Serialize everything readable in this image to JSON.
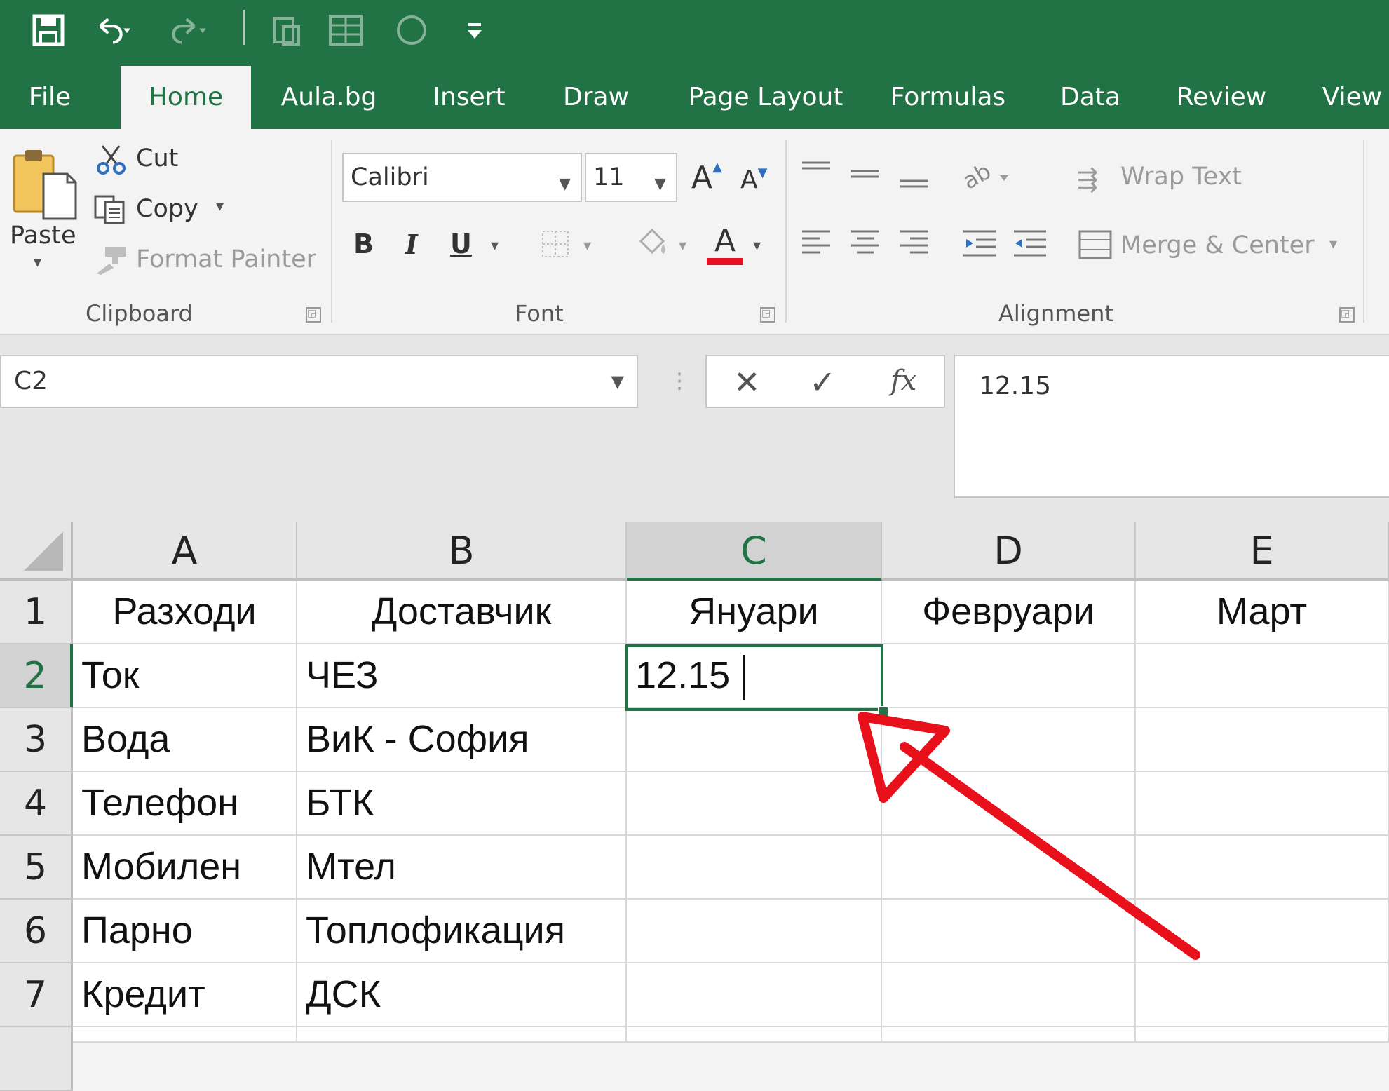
{
  "ribbon_tabs": [
    "File",
    "Home",
    "Aula.bg",
    "Insert",
    "Draw",
    "Page Layout",
    "Formulas",
    "Data",
    "Review",
    "View"
  ],
  "active_tab": "Home",
  "quick_access": {
    "icons": [
      "save-icon",
      "undo-icon",
      "redo-icon",
      "print-preview-icon",
      "table-icon",
      "circle-icon",
      "customize-qat-icon"
    ]
  },
  "clipboard": {
    "paste": "Paste",
    "cut": "Cut",
    "copy": "Copy",
    "format_painter": "Format Painter",
    "group_label": "Clipboard"
  },
  "font": {
    "family": "Calibri",
    "size": "11",
    "bold": "B",
    "italic": "I",
    "underline": "U",
    "color_glyph": "A",
    "grow_glyph": "A",
    "shrink_glyph": "A",
    "group_label": "Font",
    "font_color_hex": "#e81123"
  },
  "alignment": {
    "wrap_text": "Wrap Text",
    "merge_center": "Merge & Center",
    "group_label": "Alignment"
  },
  "formula_bar": {
    "name_box": "C2",
    "cancel": "✕",
    "enter": "✓",
    "fx": "fx",
    "value": "12.15"
  },
  "sheet": {
    "columns": [
      "A",
      "B",
      "C",
      "D",
      "E"
    ],
    "selected_column": "C",
    "rows": [
      "1",
      "2",
      "3",
      "4",
      "5",
      "6",
      "7"
    ],
    "selected_row": "2",
    "header_row": [
      "Разходи",
      "Доставчик",
      "Януари",
      "Февруари",
      "Март"
    ],
    "data": [
      [
        "Ток",
        "ЧЕЗ",
        "12.15",
        "",
        ""
      ],
      [
        "Вода",
        "ВиК - София",
        "",
        "",
        ""
      ],
      [
        "Телефон",
        "БТК",
        "",
        "",
        ""
      ],
      [
        "Мобилен",
        "Мтел",
        "",
        "",
        ""
      ],
      [
        "Парно",
        "Топлофикация",
        "",
        "",
        ""
      ],
      [
        "Кредит",
        "ДСК",
        "",
        "",
        ""
      ]
    ],
    "active_cell": "C2"
  },
  "colors": {
    "accent": "#217346",
    "arrow": "#e8101a"
  }
}
